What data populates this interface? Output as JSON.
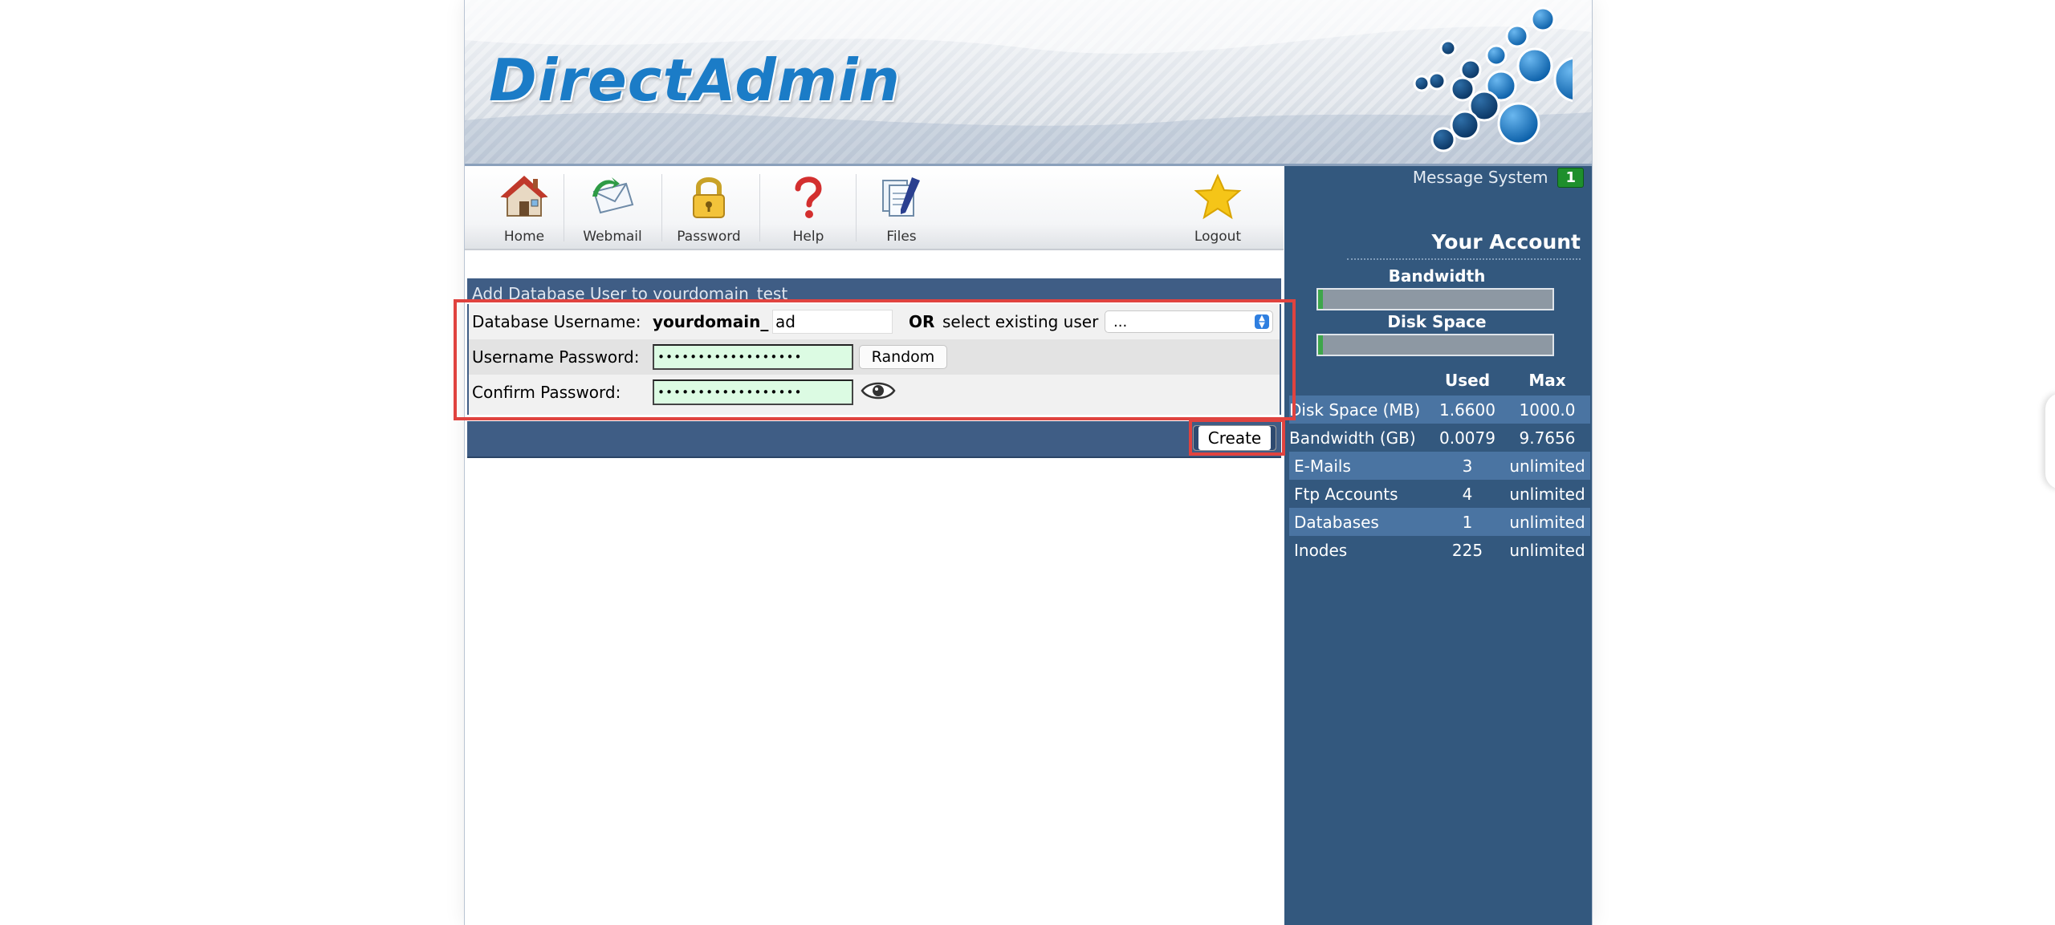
{
  "app": {
    "logo_text": "DirectAdmin"
  },
  "nav": {
    "items": [
      {
        "label": "Home",
        "icon": "home-icon"
      },
      {
        "label": "Webmail",
        "icon": "webmail-icon"
      },
      {
        "label": "Password",
        "icon": "lock-icon"
      },
      {
        "label": "Help",
        "icon": "question-icon"
      },
      {
        "label": "Files",
        "icon": "files-icon"
      },
      {
        "label": "Logout",
        "icon": "star-icon"
      }
    ]
  },
  "sidebar": {
    "message_system_label": "Message System",
    "message_count": "1",
    "account_title": "Your Account",
    "bandwidth_label": "Bandwidth",
    "bandwidth_fraction": 0.0008,
    "disk_label": "Disk Space",
    "disk_fraction": 0.0017,
    "stats": {
      "headers": [
        "",
        "Used",
        "Max"
      ],
      "rows": [
        {
          "label": "Disk Space (MB)",
          "used": "1.6600",
          "max": "1000.0"
        },
        {
          "label": "Bandwidth (GB)",
          "used": "0.0079",
          "max": "9.7656"
        },
        {
          "label": "E-Mails",
          "used": "3",
          "max": "unlimited"
        },
        {
          "label": "Ftp Accounts",
          "used": "4",
          "max": "unlimited"
        },
        {
          "label": "Databases",
          "used": "1",
          "max": "unlimited"
        },
        {
          "label": "Inodes",
          "used": "225",
          "max": "unlimited"
        }
      ]
    }
  },
  "form": {
    "title": "Add Database User to yourdomain_test",
    "username_label": "Database Username:",
    "username_prefix": "yourdomain_",
    "username_value": "ad",
    "or_label": "OR",
    "select_existing_label": "select existing user",
    "existing_user_selected": "...",
    "password_label": "Username Password:",
    "password_value": "••••••••••••••••••",
    "random_label": "Random",
    "confirm_label": "Confirm Password:",
    "confirm_value": "••••••••••••••••••",
    "create_label": "Create"
  },
  "colors": {
    "sidebar_bg": "#33587e",
    "form_bar": "#3f5d85",
    "accent_logo": "#1b7cc7",
    "password_bg": "#dcfbe3",
    "highlight": "#e0433f",
    "message_badge": "#1e8f2c"
  }
}
